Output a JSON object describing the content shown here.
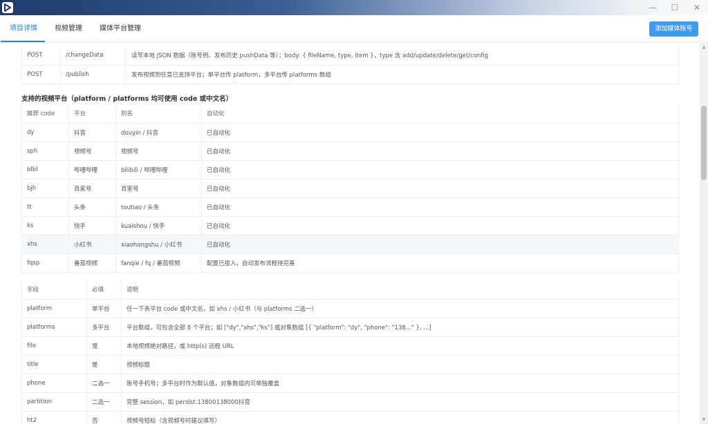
{
  "window": {
    "controls": [
      "—",
      "☐",
      "✕"
    ]
  },
  "tabs": [
    {
      "label": "项目详情",
      "active": true
    },
    {
      "label": "视频管理",
      "active": false
    },
    {
      "label": "媒体平台管理",
      "active": false
    }
  ],
  "add_button": "添加媒体账号",
  "api_table": {
    "rows": [
      {
        "method": "POST",
        "path": "/changeData",
        "desc": "读写本地 JSON 数据（账号例、发布历史 pushData 等）；body: { fileName, type, item }，type 含 add/update/delete/get/config"
      },
      {
        "method": "POST",
        "path": "/publish",
        "desc": "发布视频到任意已支持平台；单平台传 platform，多平台传 platforms 数组"
      }
    ]
  },
  "platform_section_title": "支持的视频平台（platform / platforms 均可使用 code 或中文名）",
  "platform_table": {
    "headers": [
      "推荐 code",
      "平台",
      "别名",
      "自动化"
    ],
    "rows": [
      [
        "dy",
        "抖音",
        "douyin / 抖音",
        "已自动化"
      ],
      [
        "sph",
        "视频号",
        "视频号",
        "已自动化"
      ],
      [
        "blbl",
        "哔哩哔哩",
        "bilibili / 哔哩哔哩",
        "已自动化"
      ],
      [
        "bjh",
        "百家号",
        "百家号",
        "已自动化"
      ],
      [
        "tt",
        "头条",
        "toutiao / 头条",
        "已自动化"
      ],
      [
        "ks",
        "快手",
        "kuaishou / 快手",
        "已自动化"
      ],
      [
        "xhs",
        "小红书",
        "xiaohongshu / 小红书",
        "已自动化"
      ],
      [
        "fqsp",
        "番茄视频",
        "fanqie / fq / 番茄视频",
        "配置已接入，自动发布流程待完善"
      ]
    ]
  },
  "field_table": {
    "headers": [
      "字段",
      "必填",
      "说明"
    ],
    "rows": [
      [
        "platform",
        "单平台",
        "任一下表平台 code 或中文名，如 xhs / 小红书（与 platforms 二选一）"
      ],
      [
        "platforms",
        "多平台",
        "平台数组，可包含全部 8 个平台；如 [\"dy\",\"xhs\",\"ks\"] 或对象数组 [{ \"platform\": \"dy\", \"phone\": \"138...\" }, ...]"
      ],
      [
        "file",
        "是",
        "本地视频绝对路径，或 http(s) 远程 URL"
      ],
      [
        "title",
        "是",
        "视频标题"
      ],
      [
        "phone",
        "二选一",
        "账号手机号；多平台时作为默认值，对象数组内可单独覆盖"
      ],
      [
        "partition",
        "二选一",
        "完整 session，如 persist:13800138000抖音"
      ],
      [
        "ht2",
        "否",
        "视频号短标（含视频号时建议填写）"
      ]
    ]
  }
}
